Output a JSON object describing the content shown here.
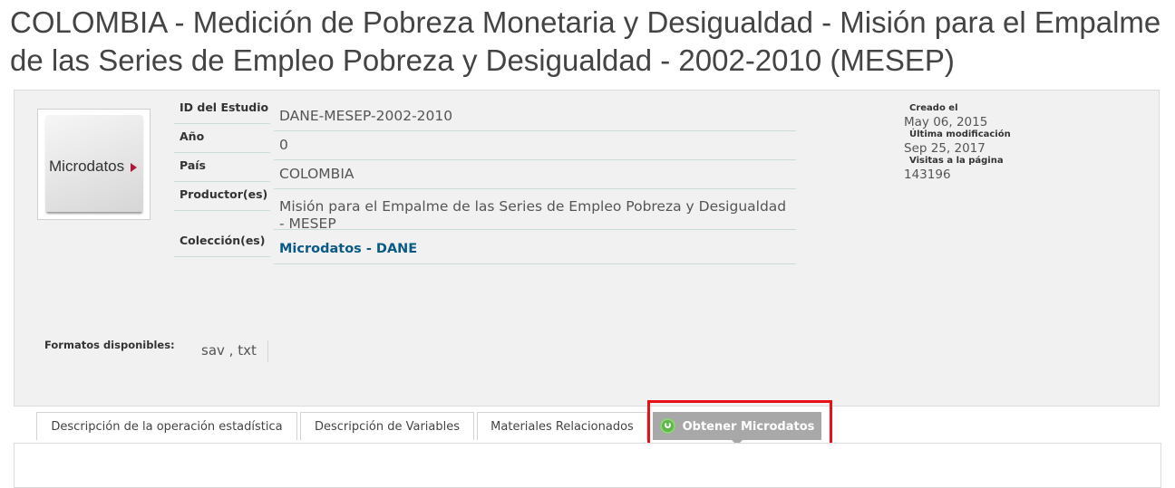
{
  "page": {
    "title": "COLOMBIA - Medición de Pobreza Monetaria y Desigualdad - Misión para el Empalme de las Series de Empleo Pobreza y Desigualdad - 2002-2010 (MESEP)"
  },
  "thumbnail": {
    "label": "Microdatos",
    "icon": "chevron-right-icon",
    "accent": "#b0183b"
  },
  "study": {
    "rows": [
      {
        "label": "ID del Estudio",
        "value": "DANE-MESEP-2002-2010"
      },
      {
        "label": "Año",
        "value": "0"
      },
      {
        "label": "País",
        "value": "COLOMBIA"
      },
      {
        "label": "Productor(es)",
        "value": "Misión para el Empalme de las Series de Empleo Pobreza y Desigualdad - MESEP"
      },
      {
        "label": "Colección(es)",
        "value": "Microdatos - DANE"
      }
    ]
  },
  "meta": {
    "created_label": "Creado el",
    "created_value": "May 06, 2015",
    "modified_label": "Última modificación",
    "modified_value": "Sep 25, 2017",
    "visits_label": "Visitas a la página",
    "visits_value": "143196"
  },
  "formats": {
    "label": "Formatos disponibles:",
    "value": "sav , txt"
  },
  "tabs": [
    {
      "label": "Descripción de la operación estadística",
      "active": false
    },
    {
      "label": "Descripción de Variables",
      "active": false
    },
    {
      "label": "Materiales Relacionados",
      "active": false
    },
    {
      "label": "Obtener Microdatos",
      "active": true,
      "icon": "download-icon"
    }
  ],
  "colors": {
    "link": "#0a5a86",
    "highlight": "#e8111a",
    "active_tab": "#a8a8a8",
    "download_icon": "#5fb84a"
  }
}
